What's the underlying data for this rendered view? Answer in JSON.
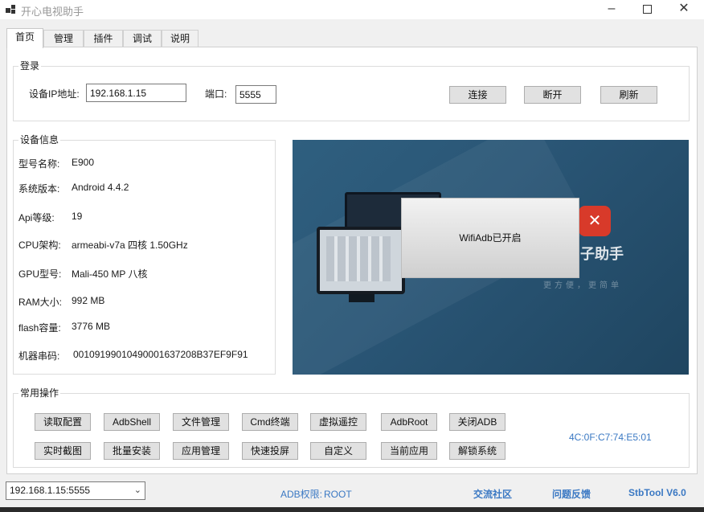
{
  "window": {
    "title": "开心电视助手",
    "min_glyph": "–",
    "close_glyph": "✕"
  },
  "tabs": [
    {
      "label": "首页",
      "active": true
    },
    {
      "label": "管理"
    },
    {
      "label": "插件"
    },
    {
      "label": "调试"
    },
    {
      "label": "说明"
    }
  ],
  "login": {
    "group_title": "登录",
    "ip_label": "设备IP地址:",
    "ip_value": "192.168.1.15",
    "port_label": "端口:",
    "port_value": "5555",
    "connect_label": "连接",
    "disconnect_label": "断开",
    "refresh_label": "刷新"
  },
  "device_info": {
    "group_title": "设备信息",
    "rows": [
      {
        "key": "型号名称:",
        "value": "E900"
      },
      {
        "key": "系统版本:",
        "value": "Android 4.4.2"
      },
      {
        "key": "Api等级:",
        "value": "19"
      },
      {
        "key": "CPU架构:",
        "value": "armeabi-v7a 四核 1.50GHz"
      },
      {
        "key": "GPU型号:",
        "value": "Mali-450 MP 八核"
      },
      {
        "key": "RAM大小:",
        "value": "992 MB"
      },
      {
        "key": "flash容量:",
        "value": "3776 MB"
      },
      {
        "key": "机器串码:",
        "value": "00109199010490001637208B37EF9F91"
      }
    ]
  },
  "banner": {
    "brand": "子助手",
    "slogan": "更方便，更简单",
    "tool_glyph": "✕",
    "toast": "WifiAdb已开启"
  },
  "operations": {
    "group_title": "常用操作",
    "row1": [
      "读取配置",
      "AdbShell",
      "文件管理",
      "Cmd终端",
      "虚拟遥控",
      "AdbRoot",
      "关闭ADB"
    ],
    "row2": [
      "实时截图",
      "批量安装",
      "应用管理",
      "快速投屏",
      "自定义",
      "当前应用",
      "解锁系统"
    ],
    "mac": "4C:0F:C7:74:E5:01"
  },
  "statusbar": {
    "device_select": "192.168.1.15:5555",
    "adb_label": "ADB权限:",
    "adb_value": "ROOT",
    "community": "交流社区",
    "feedback": "问题反馈",
    "version": "StbTool V6.0"
  },
  "colors": {
    "link": "#3a78c3",
    "button_bg": "#e1e1e1",
    "banner_bg": "#2a5676"
  }
}
